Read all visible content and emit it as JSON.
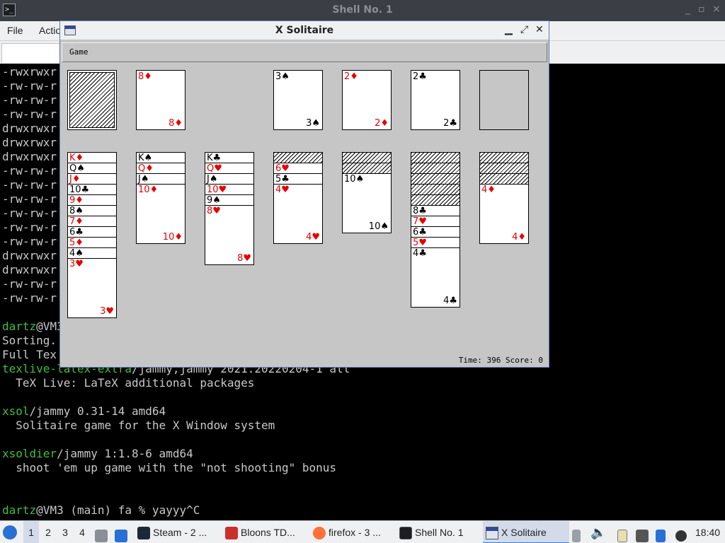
{
  "terminal": {
    "title": "Shell No. 1",
    "controls": [
      "_",
      "▫",
      "×"
    ],
    "menu": [
      "File",
      "Actio"
    ],
    "lines_hidden": [
      "-rwxrwxr",
      "-rw-rw-r",
      "-rw-rw-r",
      "-rw-rw-r",
      "drwxrwxr",
      "drwxrwxr",
      "drwxrwxr",
      "-rw-rw-r",
      "-rw-rw-r",
      "-rw-rw-r",
      "-rw-rw-r",
      "-rw-rw-r",
      "-rw-rw-r",
      "drwxrwxr",
      "drwxrwxr",
      "-rw-rw-r",
      "-rw-rw-r"
    ],
    "prompt1_user": "dartz",
    "prompt1_rest": "@VM3",
    "sorting": "Sorting.",
    "fulltext": "Full Tex",
    "pkg1_name": "texlive-latex-extra",
    "pkg1_rest": "/jammy,jammy 2021.20220204-1 all",
    "pkg1_desc": "  TeX Live: LaTeX additional packages",
    "pkg2_name": "xsol",
    "pkg2_rest": "/jammy 0.31-14 amd64",
    "pkg2_desc": "  Solitaire game for the X Window system",
    "pkg3_name": "xsoldier",
    "pkg3_rest": "/jammy 1:1.8-6 amd64",
    "pkg3_desc": "  shoot 'em up game with the \"not shooting\" bonus",
    "prompt2_user": "dartz",
    "prompt2_rest": "@VM3 (main) fa % yayyy^C"
  },
  "solitaire": {
    "title": "X Solitaire",
    "controls": [
      "▁",
      "⤢",
      "✕"
    ],
    "menu": "Game",
    "status": "Time: 396 Score: 0",
    "waste": {
      "rank": "8",
      "suit": "♦",
      "color": "red"
    },
    "foundations": [
      {
        "rank": "3",
        "suit": "♠",
        "color": "blk"
      },
      {
        "rank": "2",
        "suit": "♦",
        "color": "red"
      },
      {
        "rank": "2",
        "suit": "♣",
        "color": "blk"
      }
    ],
    "tableau": [
      {
        "hidden": 0,
        "cards": [
          {
            "rank": "K",
            "suit": "♦",
            "color": "red"
          },
          {
            "rank": "Q",
            "suit": "♠",
            "color": "blk"
          },
          {
            "rank": "J",
            "suit": "♦",
            "color": "red"
          },
          {
            "rank": "10",
            "suit": "♣",
            "color": "blk"
          },
          {
            "rank": "9",
            "suit": "♦",
            "color": "red"
          },
          {
            "rank": "8",
            "suit": "♠",
            "color": "blk"
          },
          {
            "rank": "7",
            "suit": "♦",
            "color": "red"
          },
          {
            "rank": "6",
            "suit": "♣",
            "color": "blk"
          },
          {
            "rank": "5",
            "suit": "♦",
            "color": "red"
          },
          {
            "rank": "4",
            "suit": "♠",
            "color": "blk"
          },
          {
            "rank": "3",
            "suit": "♥",
            "color": "red"
          }
        ]
      },
      {
        "hidden": 0,
        "cards": [
          {
            "rank": "K",
            "suit": "♠",
            "color": "blk"
          },
          {
            "rank": "Q",
            "suit": "♦",
            "color": "red"
          },
          {
            "rank": "J",
            "suit": "♠",
            "color": "blk"
          },
          {
            "rank": "10",
            "suit": "♦",
            "color": "red"
          }
        ]
      },
      {
        "hidden": 0,
        "cards": [
          {
            "rank": "K",
            "suit": "♣",
            "color": "blk"
          },
          {
            "rank": "Q",
            "suit": "♥",
            "color": "red"
          },
          {
            "rank": "J",
            "suit": "♠",
            "color": "blk"
          },
          {
            "rank": "10",
            "suit": "♥",
            "color": "red"
          },
          {
            "rank": "9",
            "suit": "♠",
            "color": "blk"
          },
          {
            "rank": "8",
            "suit": "♥",
            "color": "red"
          }
        ]
      },
      {
        "hidden": 1,
        "cards": [
          {
            "rank": "6",
            "suit": "♥",
            "color": "red"
          },
          {
            "rank": "5",
            "suit": "♣",
            "color": "blk"
          },
          {
            "rank": "4",
            "suit": "♥",
            "color": "red"
          }
        ]
      },
      {
        "hidden": 2,
        "cards": [
          {
            "rank": "10",
            "suit": "♠",
            "color": "blk"
          }
        ]
      },
      {
        "hidden": 5,
        "cards": [
          {
            "rank": "8",
            "suit": "♣",
            "color": "blk"
          },
          {
            "rank": "7",
            "suit": "♥",
            "color": "red"
          },
          {
            "rank": "6",
            "suit": "♣",
            "color": "blk"
          },
          {
            "rank": "5",
            "suit": "♥",
            "color": "red"
          },
          {
            "rank": "4",
            "suit": "♣",
            "color": "blk"
          }
        ]
      },
      {
        "hidden": 3,
        "cards": [
          {
            "rank": "4",
            "suit": "♦",
            "color": "red"
          }
        ]
      }
    ]
  },
  "taskbar": {
    "workspaces": [
      "1",
      "2",
      "3",
      "4"
    ],
    "tasks": [
      {
        "label": "Steam - 2 ...",
        "icon": "steam-icon"
      },
      {
        "label": "Bloons TD...",
        "icon": "bloons-icon"
      },
      {
        "label": "firefox - 3 ...",
        "icon": "firefox-icon"
      },
      {
        "label": "Shell No. 1",
        "icon": "terminal-icon"
      },
      {
        "label": "X Solitaire",
        "icon": "window-icon"
      }
    ],
    "clock": "18:40"
  }
}
